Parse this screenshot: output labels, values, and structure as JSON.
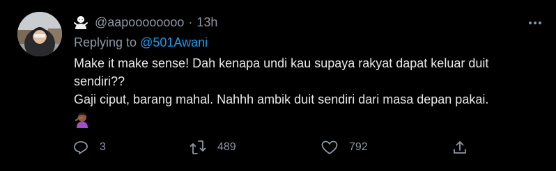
{
  "tweet": {
    "handle": "@aapoooooooo",
    "separator": "·",
    "time": "13h",
    "reply_prefix": "Replying to",
    "reply_to": "@501Awani",
    "text_line1": "Make it make sense! Dah kenapa undi kau supaya rakyat dapat keluar duit sendiri??",
    "text_line2": "Gaji ciput, barang mahal. Nahhh ambik duit sendiri dari masa depan pakai.",
    "emoji": "woman-facepalming-emoji"
  },
  "actions": {
    "replies": "3",
    "retweets": "489",
    "likes": "792"
  },
  "icons": {
    "reply": "reply-icon",
    "retweet": "retweet-icon",
    "like": "heart-icon",
    "share": "share-icon",
    "more": "more-dots-icon"
  },
  "colors": {
    "background": "#000000",
    "text": "#e7e9ea",
    "secondary": "#8b98a5",
    "link": "#1d9bf0"
  }
}
